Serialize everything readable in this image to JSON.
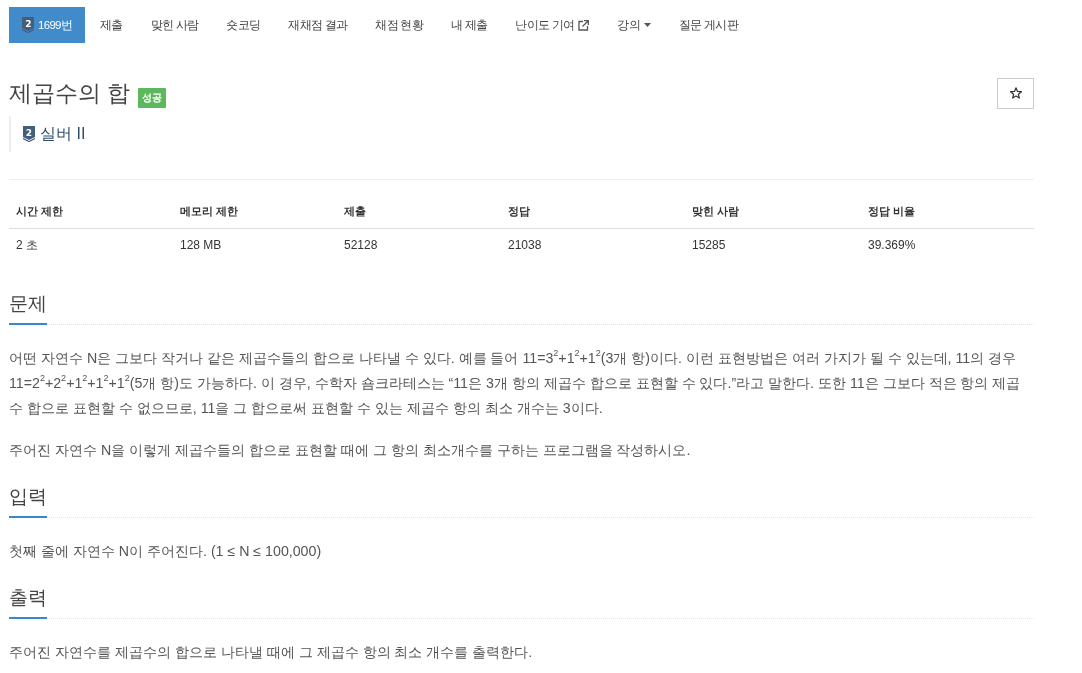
{
  "nav": {
    "tabs": [
      {
        "kind": "problem",
        "tier": "2",
        "label": "1699번",
        "selected": true
      },
      {
        "kind": "plain",
        "label": "제출",
        "selected": false
      },
      {
        "kind": "plain",
        "label": "맞힌 사람",
        "selected": false
      },
      {
        "kind": "plain",
        "label": "숏코딩",
        "selected": false
      },
      {
        "kind": "plain",
        "label": "재채점 결과",
        "selected": false
      },
      {
        "kind": "plain",
        "label": "채점 현황",
        "selected": false
      },
      {
        "kind": "plain",
        "label": "내 제출",
        "selected": false
      },
      {
        "kind": "external",
        "label": "난이도 기여",
        "selected": false
      },
      {
        "kind": "dropdown",
        "label": "강의",
        "selected": false
      },
      {
        "kind": "plain",
        "label": "질문 게시판",
        "selected": false
      }
    ]
  },
  "problem": {
    "title": "제곱수의 합",
    "result_badge": "성공",
    "starred": false,
    "tier": {
      "number": "2",
      "label": "실버 II"
    }
  },
  "table": {
    "columns": [
      "시간 제한",
      "메모리 제한",
      "제출",
      "정답",
      "맞힌 사람",
      "정답 비율"
    ],
    "rows": [
      [
        "2 초",
        "128 MB",
        "52128",
        "21038",
        "15285",
        "39.369%"
      ]
    ]
  },
  "sections": [
    {
      "title": "문제",
      "paragraphs": [
        "어떤 자연수 N은 그보다 작거나 같은 제곱수들의 합으로 나타낼 수 있다. 예를 들어 11=3$^{2}$+1$^{2}$+1$^{2}$(3개 항)이다. 이런 표현방법은 여러 가지가 될 수 있는데, 11의 경우 11=2$^{2}$+2$^{2}$+1$^{2}$+1$^{2}$+1$^{2}$(5개 항)도 가능하다. 이 경우, 수학자 숌크라테스는 “11은 3개 항의 제곱수 합으로 표현할 수 있다.”라고 말한다. 또한 11은 그보다 적은 항의 제곱수 합으로 표현할 수 없으므로, 11을 그 합으로써 표현할 수 있는 제곱수 항의 최소 개수는 3이다.",
        "주어진 자연수 N을 이렇게 제곱수들의 합으로 표현할 때에 그 항의 최소개수를 구하는 프로그램을 작성하시오."
      ]
    },
    {
      "title": "입력",
      "paragraphs": [
        "첫째 줄에 자연수 N이 주어진다. (1 ≤ N ≤ 100,000)"
      ]
    },
    {
      "title": "출력",
      "paragraphs": [
        "주어진 자연수를 제곱수의 합으로 나타낼 때에 그 제곱수 항의 최소 개수를 출력한다."
      ]
    }
  ]
}
